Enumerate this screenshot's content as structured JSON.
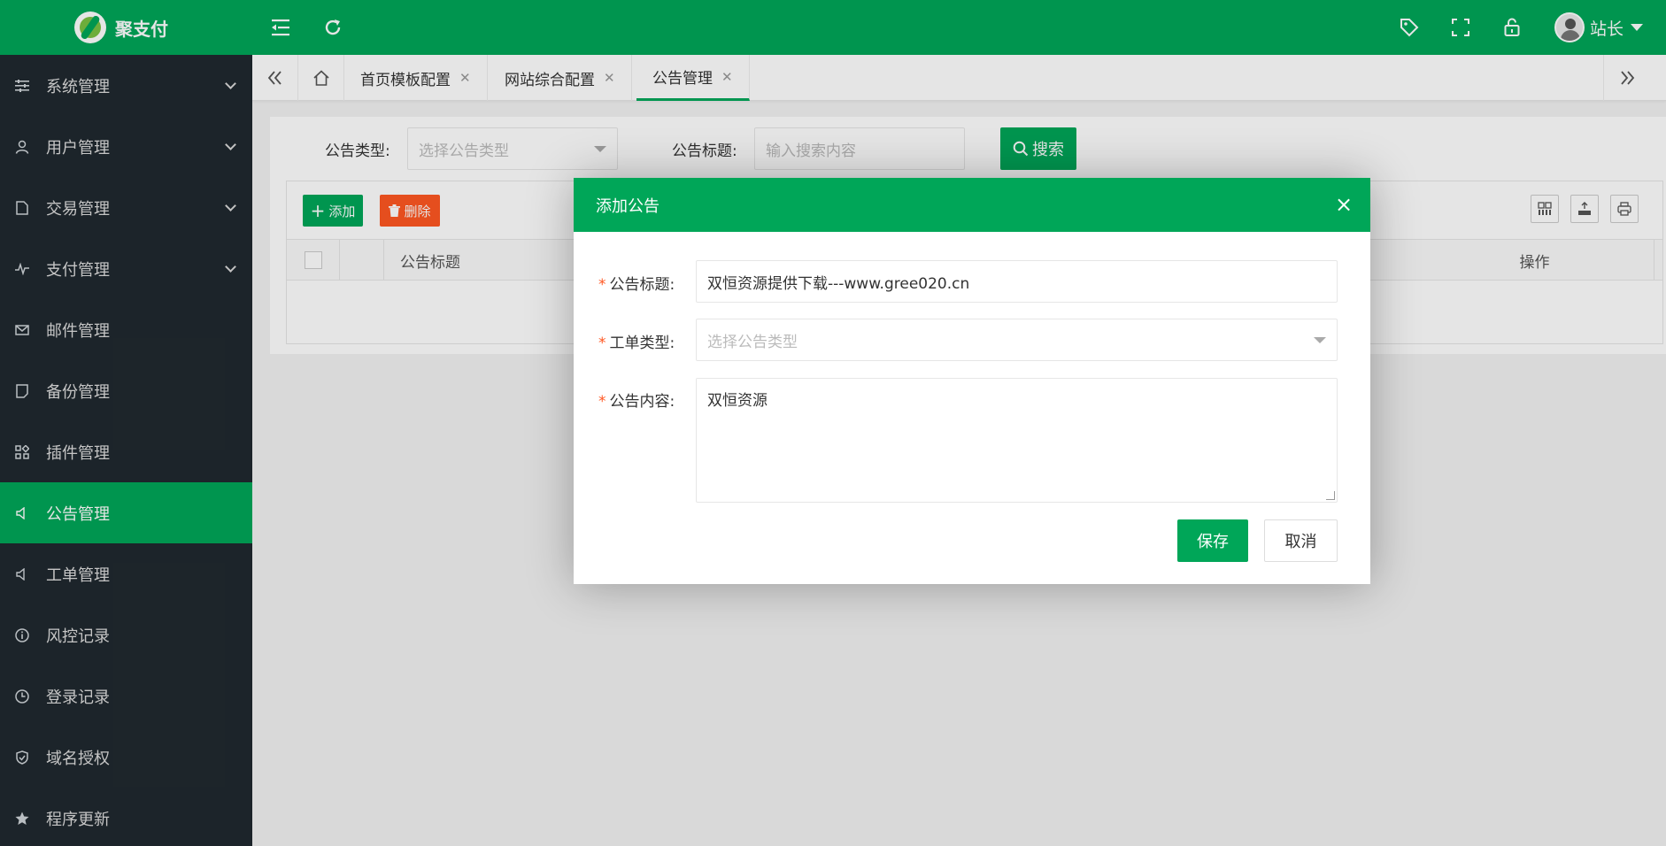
{
  "header": {
    "app_name": "聚支付",
    "icons": [
      "menu-fold-icon",
      "refresh-icon",
      "tag-icon",
      "fullscreen-icon",
      "lock-icon"
    ],
    "user_name": "站长"
  },
  "sidebar": {
    "items": [
      {
        "label": "系统管理",
        "icon": "sliders-icon",
        "expandable": true
      },
      {
        "label": "用户管理",
        "icon": "user-icon",
        "expandable": true
      },
      {
        "label": "交易管理",
        "icon": "file-icon",
        "expandable": true
      },
      {
        "label": "支付管理",
        "icon": "pulse-icon",
        "expandable": true
      },
      {
        "label": "邮件管理",
        "icon": "mail-icon",
        "expandable": false
      },
      {
        "label": "备份管理",
        "icon": "note-icon",
        "expandable": false
      },
      {
        "label": "插件管理",
        "icon": "apps-icon",
        "expandable": false
      },
      {
        "label": "公告管理",
        "icon": "speaker-icon",
        "expandable": false,
        "active": true
      },
      {
        "label": "工单管理",
        "icon": "speaker-icon",
        "expandable": false
      },
      {
        "label": "风控记录",
        "icon": "info-icon",
        "expandable": false
      },
      {
        "label": "登录记录",
        "icon": "clock-icon",
        "expandable": false
      },
      {
        "label": "域名授权",
        "icon": "shield-icon",
        "expandable": false
      },
      {
        "label": "程序更新",
        "icon": "star-icon",
        "expandable": false
      }
    ]
  },
  "tabs": [
    {
      "label": "首页模板配置",
      "closable": true
    },
    {
      "label": "网站综合配置",
      "closable": true
    },
    {
      "label": "公告管理",
      "closable": true,
      "active": true
    }
  ],
  "search": {
    "type_label": "公告类型:",
    "type_placeholder": "选择公告类型",
    "title_label": "公告标题:",
    "title_placeholder": "输入搜索内容",
    "search_button": "搜索"
  },
  "table": {
    "add_button": "添加",
    "delete_button": "删除",
    "columns": [
      "公告标题",
      "操作"
    ]
  },
  "modal": {
    "title": "添加公告",
    "fields": {
      "title_label": "公告标题:",
      "title_value": "双恒资源提供下载---www.gree020.cn",
      "type_label": "工单类型:",
      "type_placeholder": "选择公告类型",
      "content_label": "公告内容:",
      "content_value": "双恒资源"
    },
    "save_button": "保存",
    "cancel_button": "取消"
  },
  "colors": {
    "primary": "#00a658",
    "danger": "#ff5722",
    "sidebar_bg": "#20292f"
  }
}
